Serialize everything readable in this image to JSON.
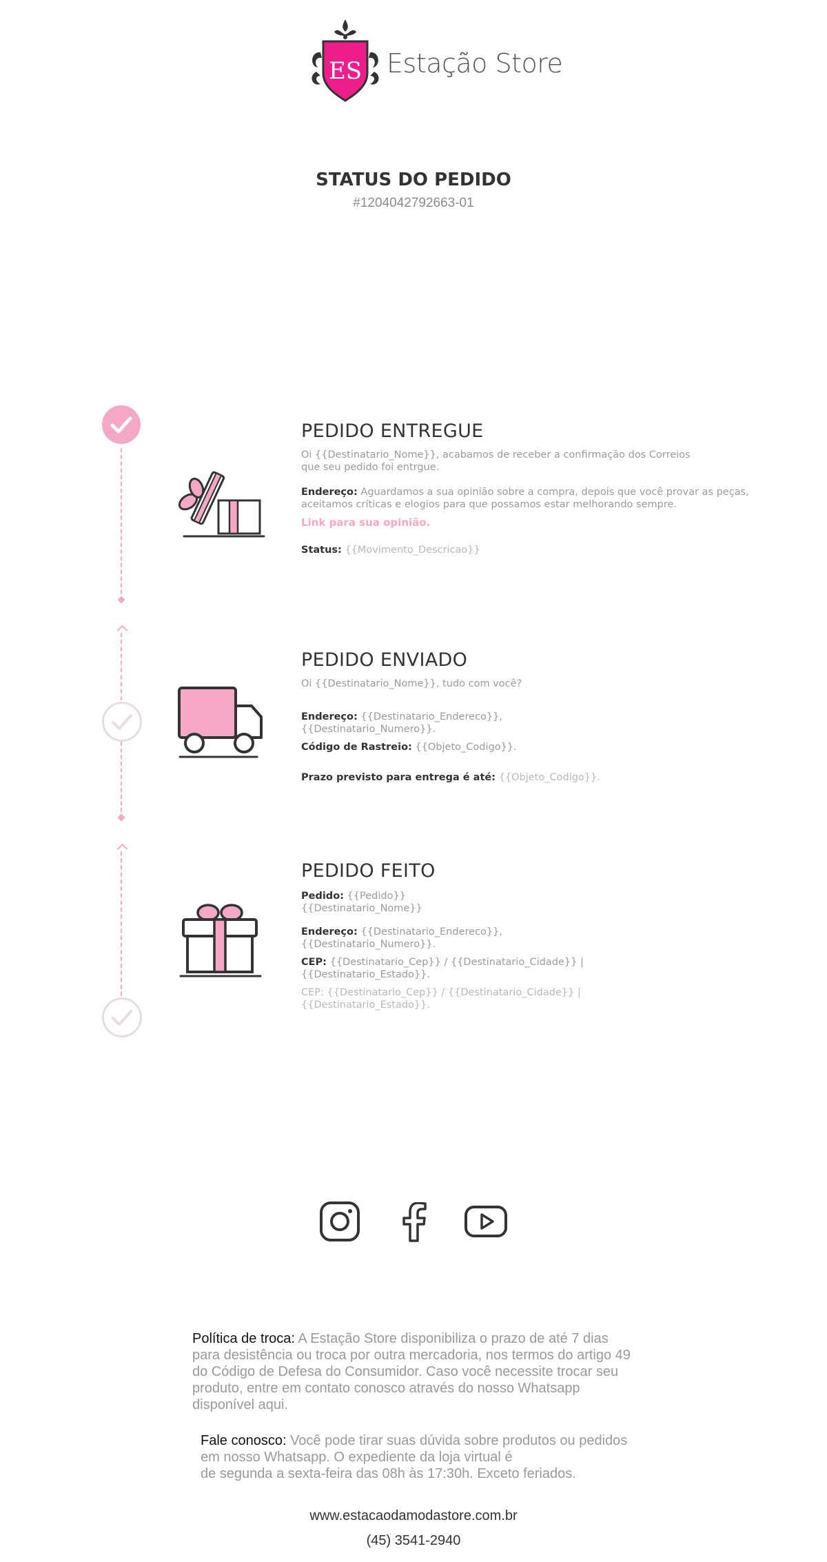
{
  "header": {
    "logo_monogram": "ES",
    "brand_name": "Estação Store"
  },
  "order": {
    "title": "STATUS DO PEDIDO",
    "number": "#1204042792663-01"
  },
  "colors": {
    "accent_pink": "#f4a8c5",
    "logo_pink": "#ec1e8c",
    "dark_text": "#333333",
    "muted_text": "#9a9a9a"
  },
  "sections": {
    "delivered": {
      "icon": "open-gift-box-icon",
      "title": "PEDIDO ENTREGUE",
      "line1": "Oi {{Destinatario_Nome}}, acabamos de receber a confirmação dos Correios",
      "line2": "que seu pedido foi entrgue.",
      "address_label": "Endereço:",
      "address_text1": " Aguardamos a sua opinião sobre a compra, depois que você provar as peças,",
      "address_text2": "aceitamos críticas e elogios para que possamos estar melhorando sempre.",
      "link": "Link para sua opinião.",
      "status_label": "Status:",
      "status_value": " {{Movimento_Descricao}}"
    },
    "shipped": {
      "icon": "delivery-truck-icon",
      "title": "PEDIDO ENVIADO",
      "greeting": "Oi {{Destinatario_Nome}}, tudo com você?",
      "address_label": "Endereço:",
      "address_value1": " {{Destinatario_Endereco}},",
      "address_value2": "{{Destinatario_Numero}}.",
      "tracking_label": "Código de Rastreio:",
      "tracking_value": " {{Objeto_Codigo}}.",
      "eta_label": "Prazo previsto para entrega é até:",
      "eta_value": " {{Objeto_Codigo}}."
    },
    "placed": {
      "icon": "gift-box-icon",
      "title": "PEDIDO FEITO",
      "order_label": "Pedido:",
      "order_value": " {{Pedido}}",
      "name_value": "{{Destinatario_Nome}}",
      "address_label": "Endereço:",
      "address_value1": " {{Destinatario_Endereco}},",
      "address_value2": "{{Destinatario_Numero}}.",
      "cep_label": "CEP:",
      "cep_value1": " {{Destinatario_Cep}} / {{Destinatario_Cidade}} |",
      "cep_value2": "{{Destinatario_Estado}}.",
      "cep2_label": "CEP:",
      "cep2_value1": " {{Destinatario_Cep}} / {{Destinatario_Cidade}} |",
      "cep2_value2": "{{Destinatario_Estado}}."
    }
  },
  "social": {
    "instagram": "instagram-icon",
    "facebook": "facebook-icon",
    "youtube": "youtube-icon"
  },
  "footer": {
    "policy_label": "Política de troca:",
    "policy_line1": " A Estação Store disponibiliza o prazo de até 7 dias",
    "policy_line2": "para desistência ou troca por outra mercadoria, nos termos do artigo 49",
    "policy_line3": "do Código de Defesa do Consumidor. Caso você necessite trocar seu",
    "policy_line4": "produto, entre em contato conosco através do nosso Whatsapp",
    "policy_line5": "disponível aqui.",
    "contact_label": "Fale conosco:",
    "contact_line1": " Você pode tirar suas dúvida sobre produtos ou pedidos",
    "contact_line2": "em nosso Whatsapp. O expediente da loja virtual é",
    "contact_line3": "de segunda a sexta-feira das 08h às 17:30h. Exceto feriados.",
    "website": "www.estacaodamodastore.com.br",
    "phone": "(45) 3541-2940"
  }
}
